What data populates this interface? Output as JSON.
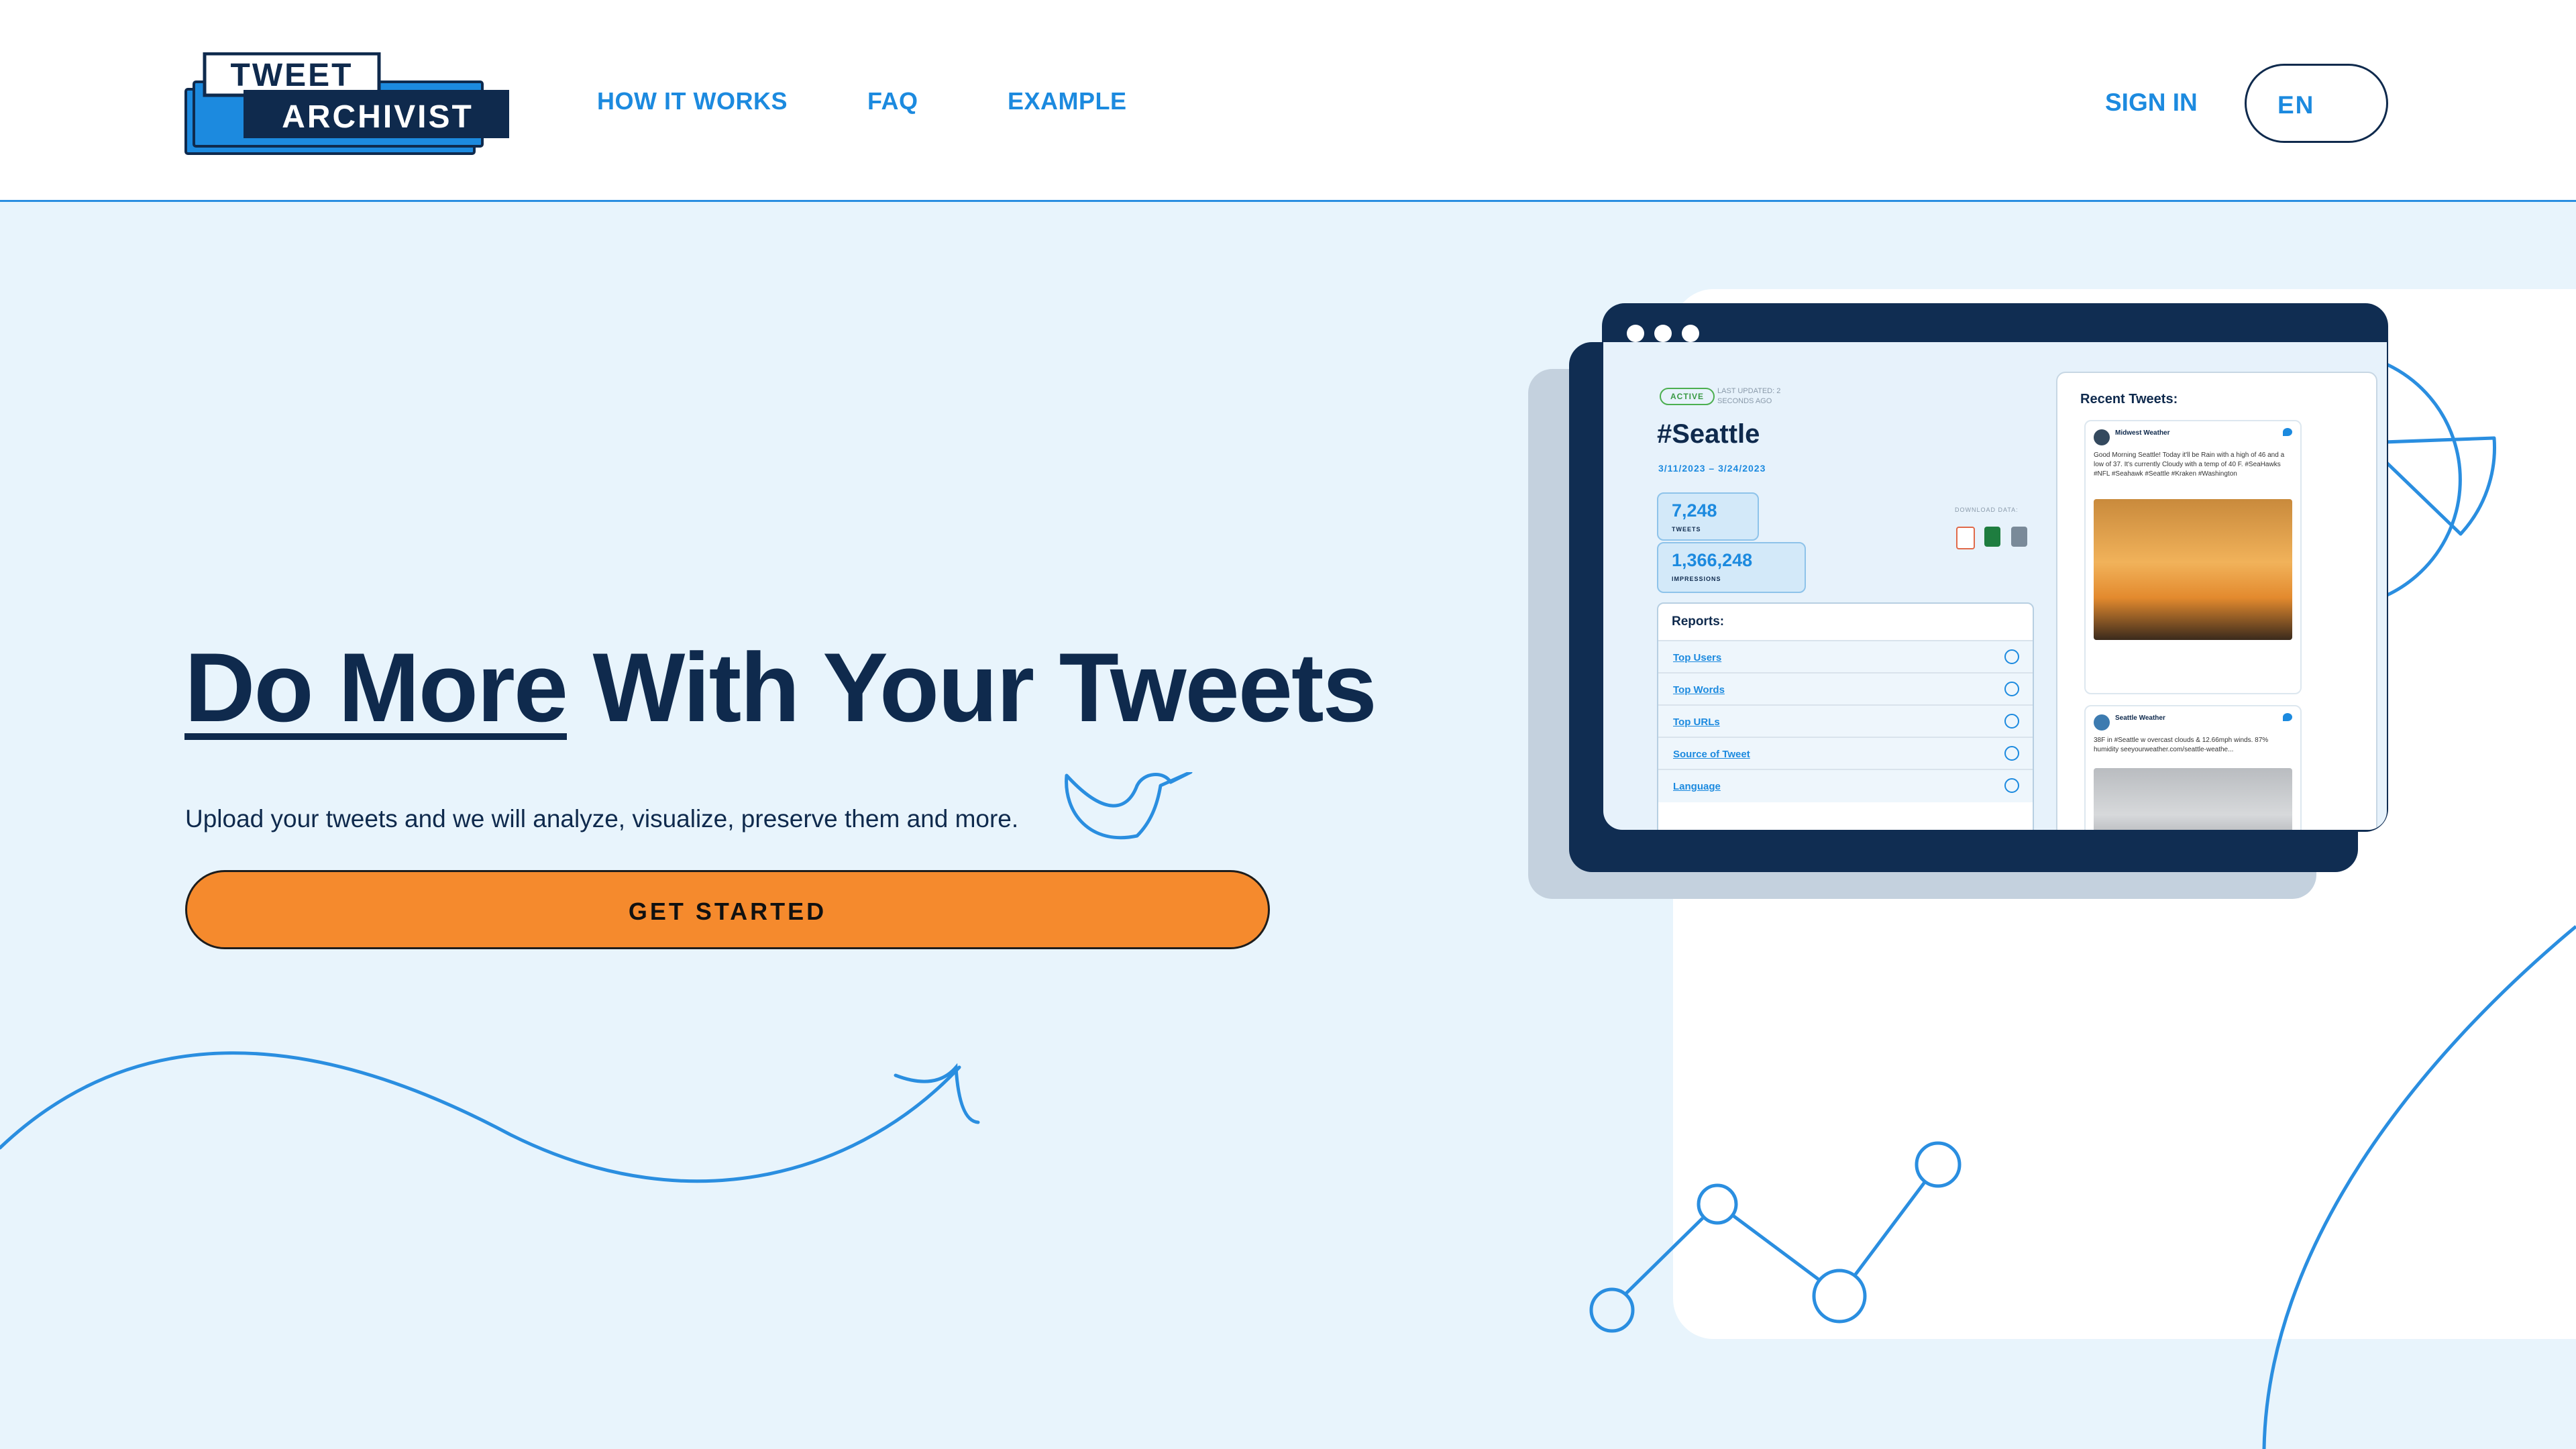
{
  "brand": {
    "logo_line1": "TWEET",
    "logo_line2": "ARCHIVIST"
  },
  "nav": {
    "links": [
      "HOW IT WORKS",
      "FAQ",
      "EXAMPLE"
    ],
    "sign_in": "SIGN IN",
    "language": "EN"
  },
  "hero": {
    "headline_underlined": "Do More",
    "headline_rest": " With Your Tweets",
    "subtitle": "Upload your tweets and we will analyze, visualize, preserve them and more.",
    "cta": "GET STARTED"
  },
  "mockup": {
    "status_badge": "ACTIVE",
    "last_updated": "LAST UPDATED: 2 SECONDS AGO",
    "title": "#Seattle",
    "dates": "3/11/2023 – 3/24/2023",
    "stats": [
      {
        "value": "7,248",
        "label": "TWEETS"
      },
      {
        "value": "1,366,248",
        "label": "IMPRESSIONS"
      }
    ],
    "download_label": "DOWNLOAD DATA:",
    "reports_title": "Reports:",
    "reports": [
      "Top Users",
      "Top Words",
      "Top URLs",
      "Source of Tweet",
      "Language"
    ],
    "recent_title": "Recent Tweets:",
    "tweets": [
      {
        "author": "Midwest Weather",
        "text": "Good Morning Seattle! Today it'll be Rain with a high of 46 and a low of 37. It's currently Cloudy with a temp of 40 F. #SeaHawks #NFL #Seahawk #Seattle #Kraken #Washington"
      },
      {
        "author": "Seattle Weather",
        "text": "38F in #Seattle w overcast clouds & 12.66mph winds. 87% humidity seeyourweather.com/seattle-weathe..."
      }
    ]
  },
  "colors": {
    "primary_blue": "#1c8adf",
    "navy": "#0f2a4d",
    "hero_bg": "#e8f4fc",
    "cta_orange": "#f58a2d"
  },
  "icons": [
    "logo-icon",
    "bird-icon",
    "pie-chart-icon",
    "line-chart-icon",
    "swoosh-arrow-icon"
  ]
}
